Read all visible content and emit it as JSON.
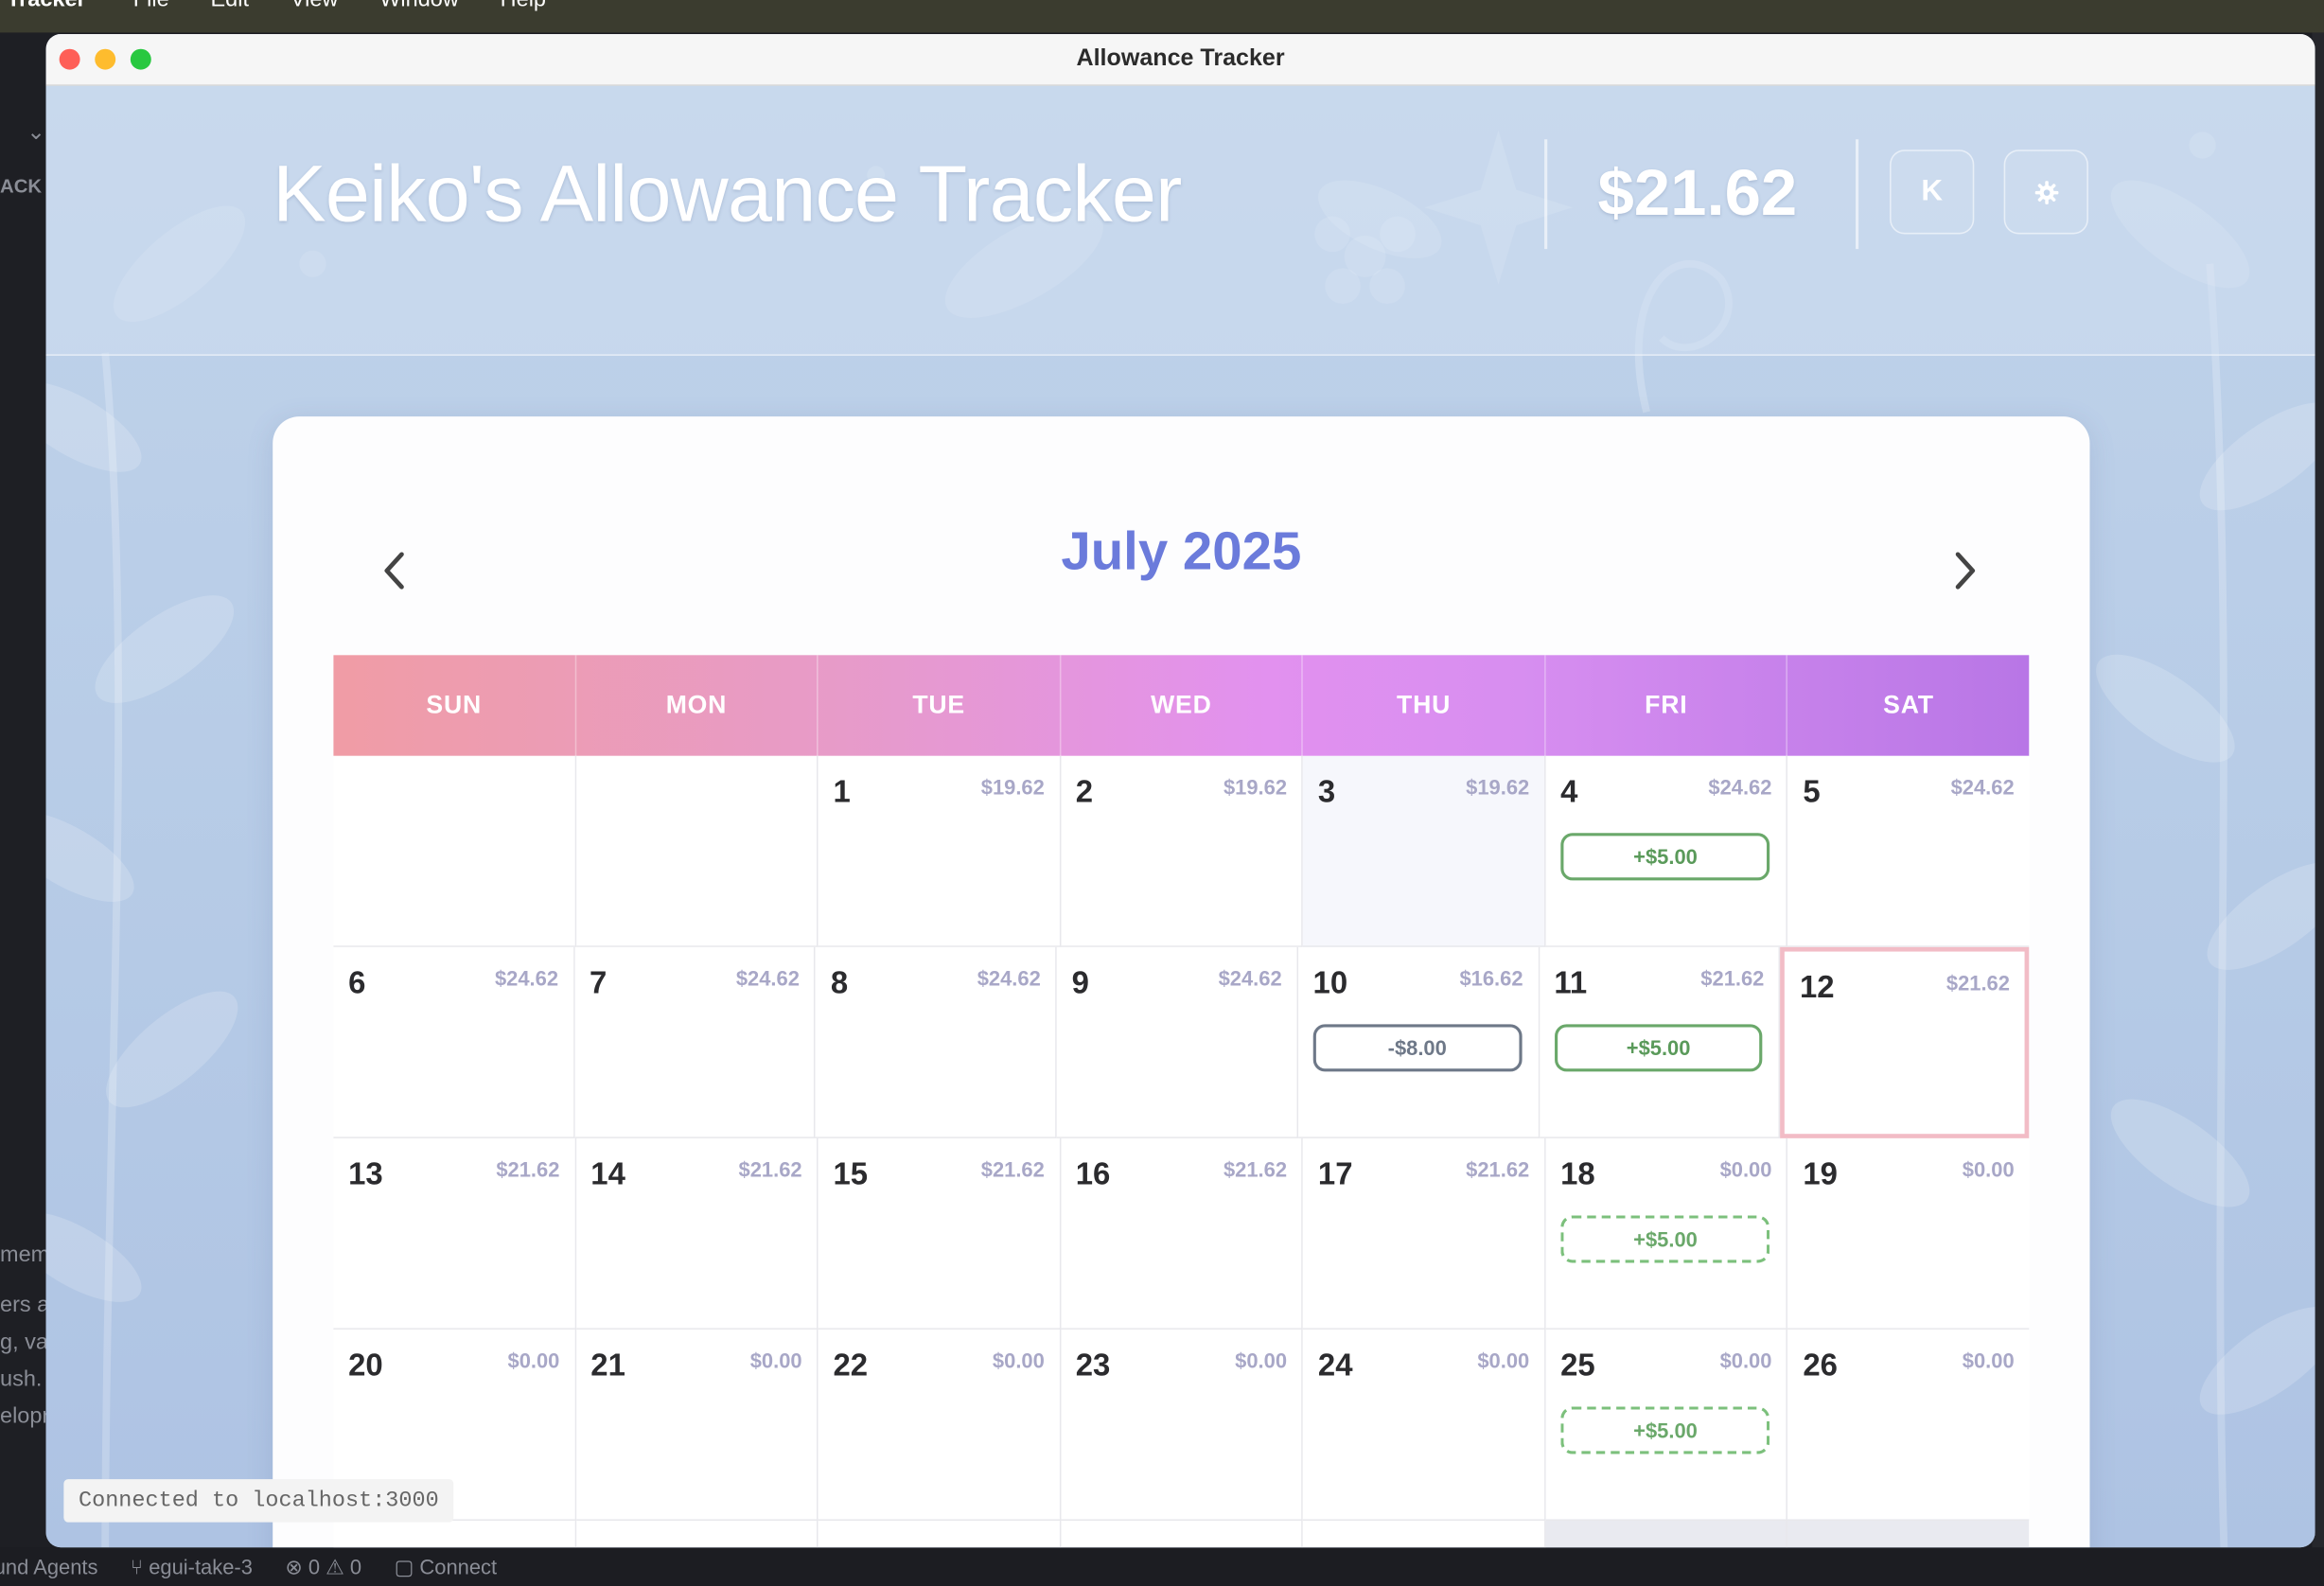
{
  "menubar": {
    "app_name": "e Tracker",
    "items": [
      "File",
      "Edit",
      "View",
      "Window",
      "Help"
    ]
  },
  "ide": {
    "left_fragments": [
      "ACK",
      "mem",
      "ers a",
      "g, va",
      "ush.",
      "elopr"
    ],
    "status_items": [
      "und Agents",
      "egui-take-3",
      "0",
      "0",
      "Connect"
    ]
  },
  "window": {
    "title": "Allowance Tracker",
    "lights": [
      "#fe5f57",
      "#febc2e",
      "#28c840"
    ]
  },
  "header": {
    "title": "Keiko's Allowance Tracker",
    "balance": "$21.62",
    "avatar_initial": "K",
    "settings_icon": "gear-icon"
  },
  "calendar": {
    "month_label": "July 2025",
    "prev_icon": "chevron-left-icon",
    "next_icon": "chevron-right-icon",
    "weekdays": [
      "SUN",
      "MON",
      "TUE",
      "WED",
      "THU",
      "FRI",
      "SAT"
    ],
    "weeks": [
      [
        {
          "day": "",
          "amount": ""
        },
        {
          "day": "",
          "amount": ""
        },
        {
          "day": "1",
          "amount": "$19.62"
        },
        {
          "day": "2",
          "amount": "$19.62"
        },
        {
          "day": "3",
          "amount": "$19.62",
          "shaded": true
        },
        {
          "day": "4",
          "amount": "$24.62",
          "txn": {
            "label": "+$5.00",
            "kind": "pos"
          }
        },
        {
          "day": "5",
          "amount": "$24.62"
        }
      ],
      [
        {
          "day": "6",
          "amount": "$24.62"
        },
        {
          "day": "7",
          "amount": "$24.62"
        },
        {
          "day": "8",
          "amount": "$24.62"
        },
        {
          "day": "9",
          "amount": "$24.62"
        },
        {
          "day": "10",
          "amount": "$16.62",
          "txn": {
            "label": "-$8.00",
            "kind": "neg"
          }
        },
        {
          "day": "11",
          "amount": "$21.62",
          "txn": {
            "label": "+$5.00",
            "kind": "pos"
          }
        },
        {
          "day": "12",
          "amount": "$21.62",
          "today": true
        }
      ],
      [
        {
          "day": "13",
          "amount": "$21.62"
        },
        {
          "day": "14",
          "amount": "$21.62"
        },
        {
          "day": "15",
          "amount": "$21.62"
        },
        {
          "day": "16",
          "amount": "$21.62"
        },
        {
          "day": "17",
          "amount": "$21.62"
        },
        {
          "day": "18",
          "amount": "$0.00",
          "txn": {
            "label": "+$5.00",
            "kind": "pending"
          }
        },
        {
          "day": "19",
          "amount": "$0.00"
        }
      ],
      [
        {
          "day": "20",
          "amount": "$0.00"
        },
        {
          "day": "21",
          "amount": "$0.00"
        },
        {
          "day": "22",
          "amount": "$0.00"
        },
        {
          "day": "23",
          "amount": "$0.00"
        },
        {
          "day": "24",
          "amount": "$0.00"
        },
        {
          "day": "25",
          "amount": "$0.00",
          "txn": {
            "label": "+$5.00",
            "kind": "pending"
          }
        },
        {
          "day": "26",
          "amount": "$0.00"
        }
      ]
    ]
  },
  "connection_status": "Connected to localhost:3000"
}
